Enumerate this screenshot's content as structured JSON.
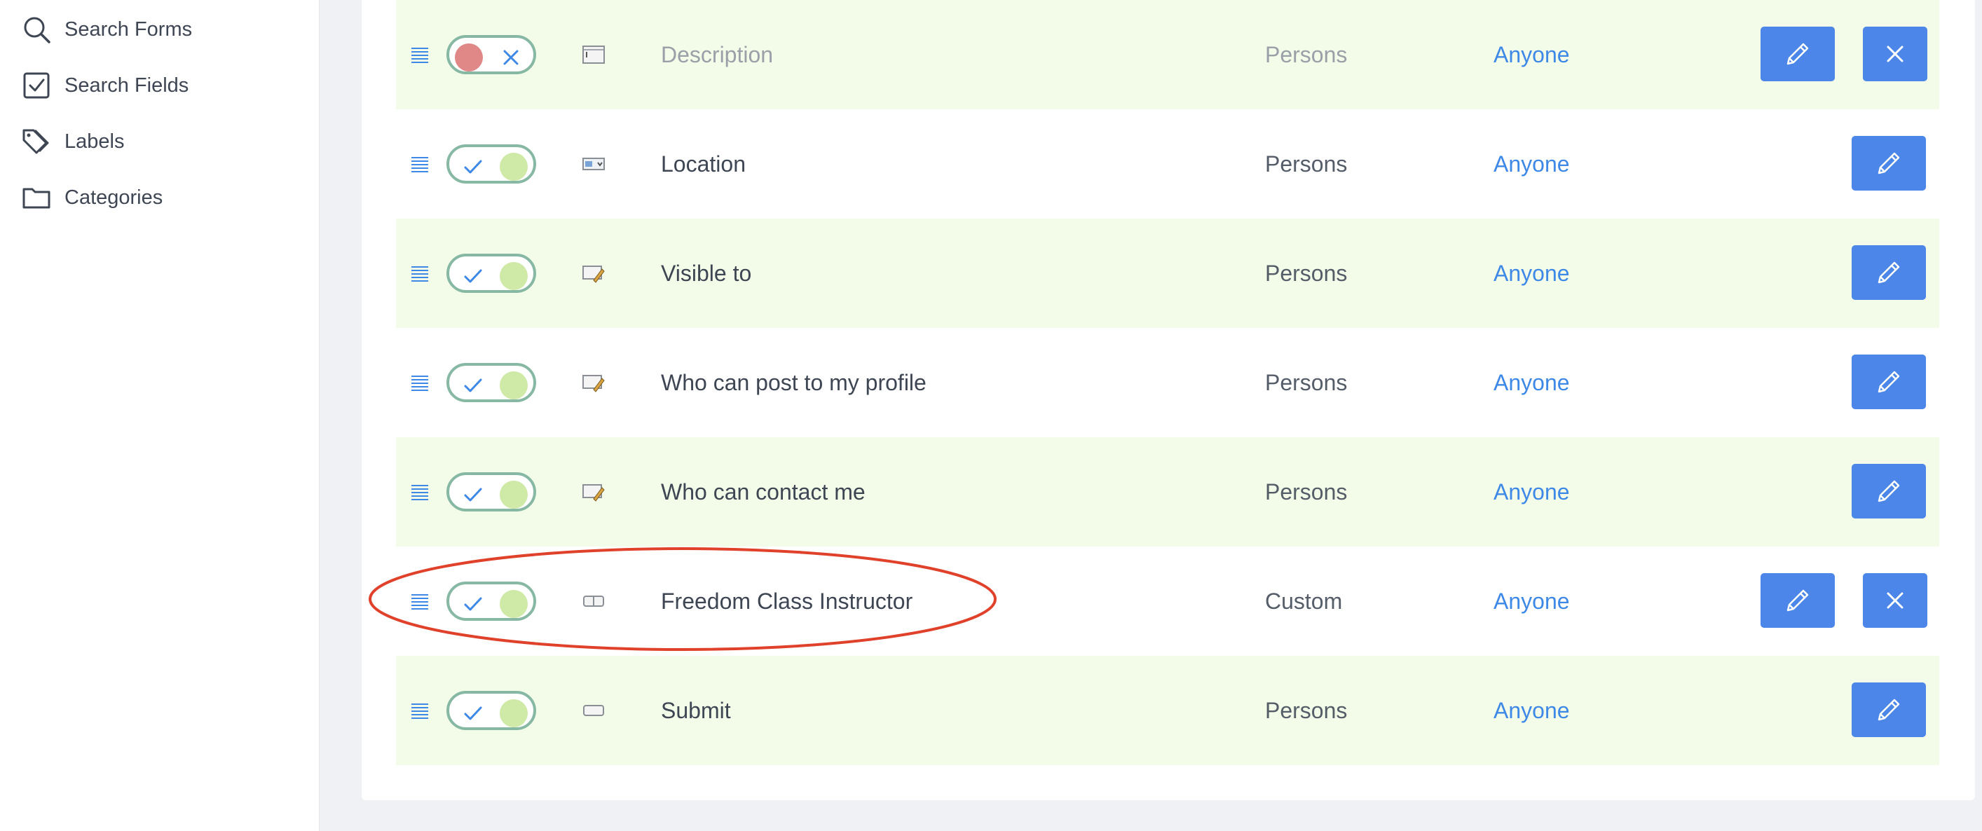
{
  "sidebar": {
    "items": [
      {
        "label": "Search Forms",
        "icon": "search-icon"
      },
      {
        "label": "Search Fields",
        "icon": "checkbox-icon"
      },
      {
        "label": "Labels",
        "icon": "tags-icon"
      },
      {
        "label": "Categories",
        "icon": "folder-icon"
      }
    ]
  },
  "fields": {
    "rows": [
      {
        "title": "Description",
        "profile_type": "Persons",
        "access": "Anyone",
        "published": false,
        "field_icon": "textarea-icon",
        "deletable": true
      },
      {
        "title": "Location",
        "profile_type": "Persons",
        "access": "Anyone",
        "published": true,
        "field_icon": "location-field-icon",
        "deletable": false
      },
      {
        "title": "Visible to",
        "profile_type": "Persons",
        "access": "Anyone",
        "published": true,
        "field_icon": "privacy-field-icon",
        "deletable": false
      },
      {
        "title": "Who can post to my profile",
        "profile_type": "Persons",
        "access": "Anyone",
        "published": true,
        "field_icon": "privacy-field-icon",
        "deletable": false
      },
      {
        "title": "Who can contact me",
        "profile_type": "Persons",
        "access": "Anyone",
        "published": true,
        "field_icon": "privacy-field-icon",
        "deletable": false
      },
      {
        "title": "Freedom Class Instructor",
        "profile_type": "Custom",
        "access": "Anyone",
        "published": true,
        "field_icon": "checkbox-field-icon",
        "deletable": true
      },
      {
        "title": "Submit",
        "profile_type": "Persons",
        "access": "Anyone",
        "published": true,
        "field_icon": "button-field-icon",
        "deletable": false
      }
    ]
  },
  "colors": {
    "accent": "#4b86e8",
    "link": "#3f89e6",
    "row_highlight": "#f3fce9",
    "toggle_border": "#86b8a3",
    "toggle_on_knob": "#cfe9a6",
    "toggle_off_knob": "#e08787",
    "annotation": "#e0412b"
  }
}
